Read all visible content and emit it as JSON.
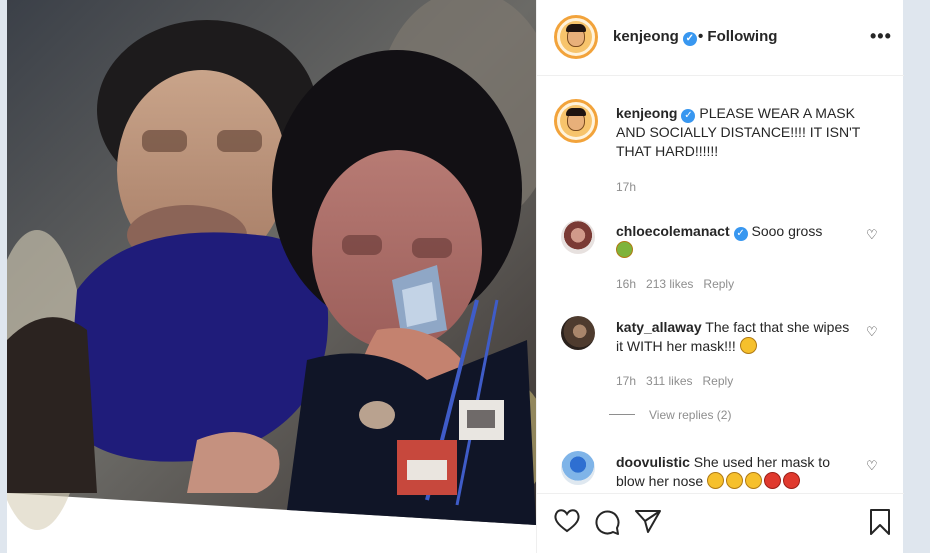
{
  "post": {
    "author": "kenjeong",
    "follow_status": "• Following",
    "more_label": "•••"
  },
  "caption": {
    "username": "kenjeong",
    "text": "PLEASE WEAR A MASK AND SOCIALLY DISTANCE!!!! IT ISN'T THAT HARD!!!!!!",
    "time": "17h"
  },
  "comments": [
    {
      "username": "chloecolemanact",
      "verified": true,
      "text": "Sooo gross",
      "emojis": [
        "nauseated-face"
      ],
      "time": "16h",
      "likes": "213 likes",
      "reply": "Reply"
    },
    {
      "username": "katy_allaway",
      "verified": false,
      "text": "The fact that she wipes it WITH her mask!!!",
      "emojis": [
        "astonished-face"
      ],
      "time": "17h",
      "likes": "311 likes",
      "reply": "Reply"
    },
    {
      "username": "doovulistic",
      "verified": false,
      "text": "She used her mask to blow her nose",
      "emojis": [
        "flushed-face",
        "flushed-face",
        "flushed-face",
        "angry-face",
        "angry-face"
      ]
    }
  ],
  "view_replies": "View replies (2)",
  "icons": {
    "like": "heart-outline-icon",
    "comment": "comment-bubble-icon",
    "share": "paper-plane-icon",
    "save": "bookmark-icon",
    "verified": "verified-badge-icon"
  },
  "colors": {
    "verified": "#3897f0",
    "secondary_text": "#8e8e8e"
  }
}
